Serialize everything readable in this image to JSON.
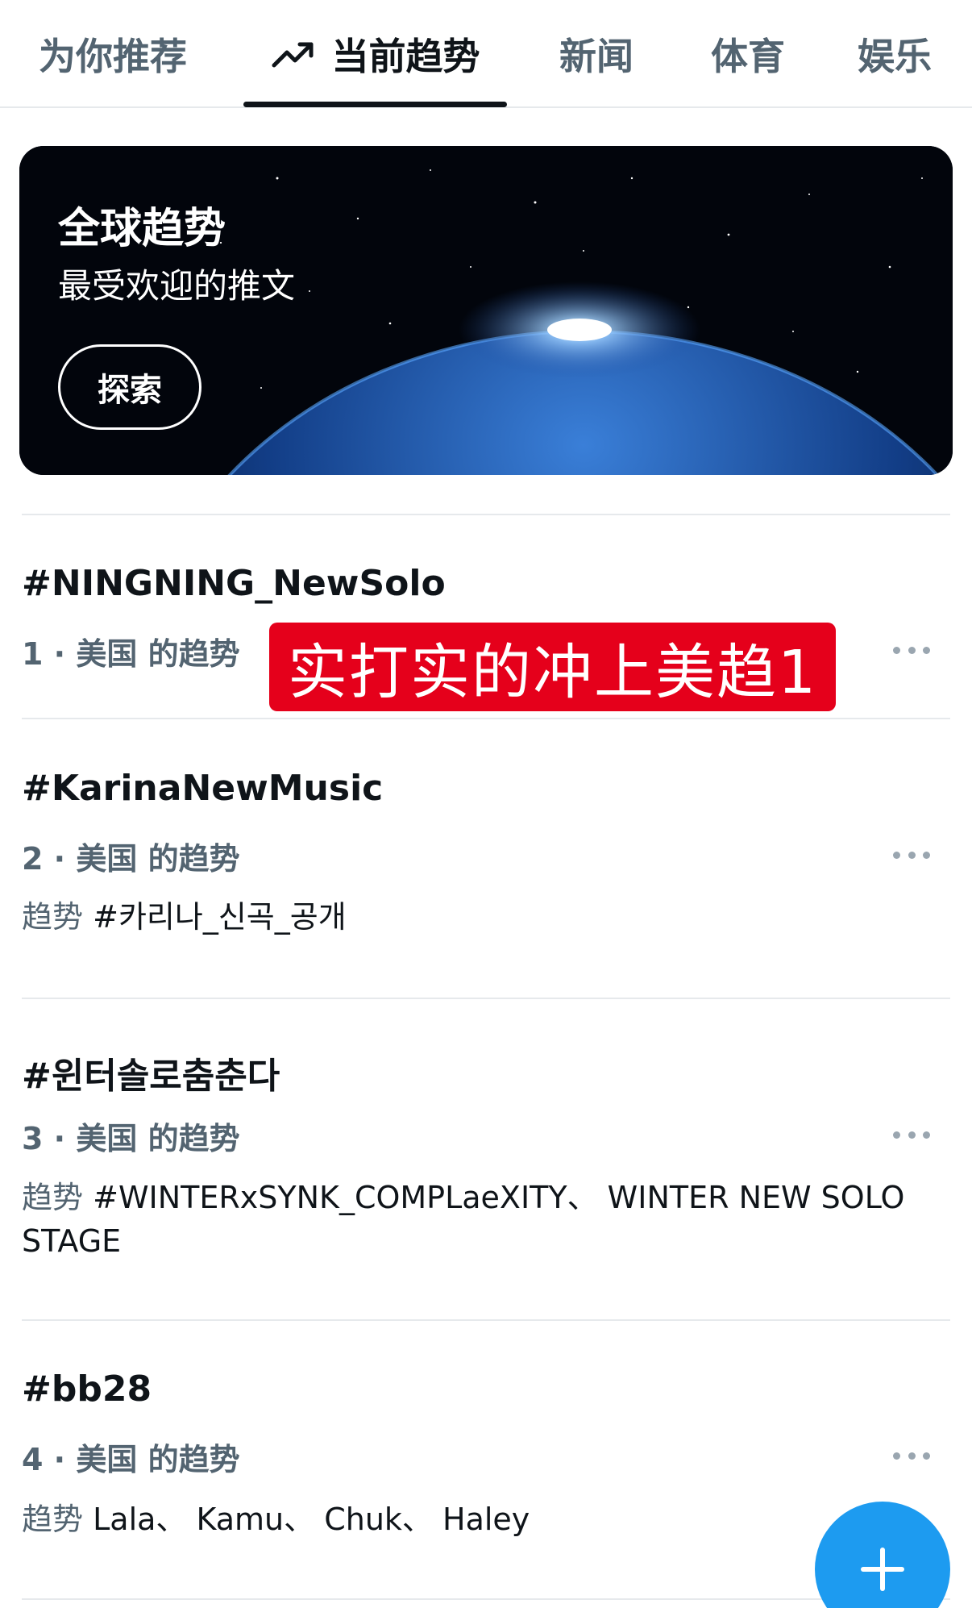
{
  "tabs": [
    {
      "label": "为你推荐"
    },
    {
      "label": "当前趋势",
      "icon": "trending-arrow-icon",
      "active": true
    },
    {
      "label": "新闻"
    },
    {
      "label": "体育"
    },
    {
      "label": "娱乐"
    }
  ],
  "banner": {
    "title": "全球趋势",
    "subtitle": "最受欢迎的推文",
    "button_label": "探索"
  },
  "overlay_caption": "实打实的冲上美趋1",
  "trends": [
    {
      "name": "#NINGNING_NewSolo",
      "meta": "1 · 美国 的趋势",
      "related_label": "",
      "related": ""
    },
    {
      "name": "#KarinaNewMusic",
      "meta": "2 · 美国 的趋势",
      "related_label": "趋势",
      "related": "#카리나_신곡_공개"
    },
    {
      "name": "#윈터솔로춤춘다",
      "meta": "3 · 美国 的趋势",
      "related_label": "趋势",
      "related": "#WINTERxSYNK_COMPLaeXITY、 WINTER NEW SOLO STAGE"
    },
    {
      "name": "#bb28",
      "meta": "4 · 美国 的趋势",
      "related_label": "趋势",
      "related": "Lala、 Kamu、 Chuk、 Haley"
    }
  ],
  "colors": {
    "accent": "#1d9bf0",
    "overlay_red": "#e5001b",
    "secondary_text": "#536471"
  },
  "fab": {
    "icon": "plus-icon"
  }
}
